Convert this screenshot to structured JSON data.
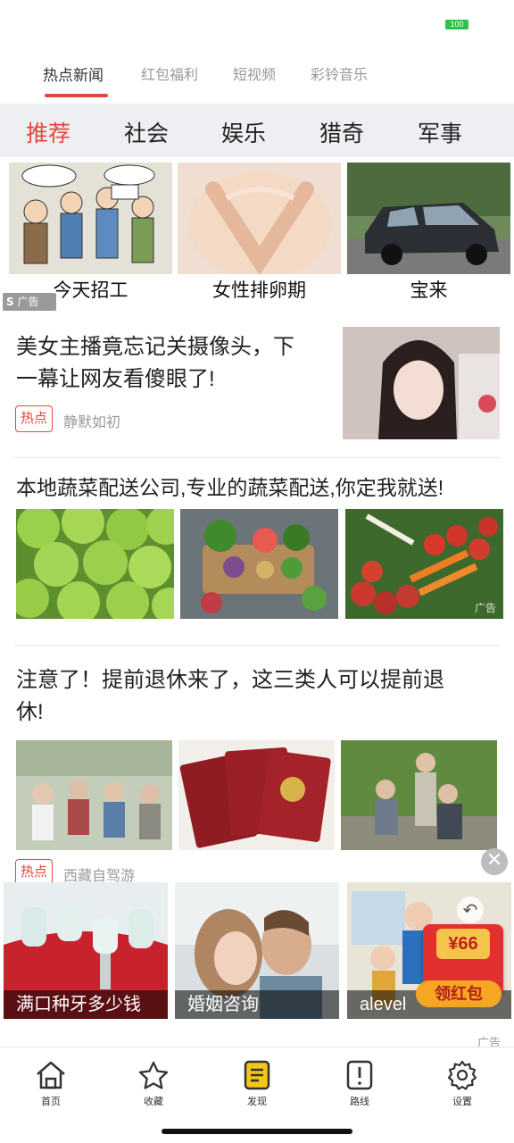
{
  "status": {
    "battery": "100",
    "battery_color": "#2cc24a"
  },
  "top_tabs": [
    {
      "label": "热点新闻"
    },
    {
      "label": "红包福利"
    },
    {
      "label": "短视频"
    },
    {
      "label": "彩铃音乐"
    }
  ],
  "categories": [
    {
      "label": "推荐"
    },
    {
      "label": "社会"
    },
    {
      "label": "娱乐"
    },
    {
      "label": "猎奇"
    },
    {
      "label": "军事"
    }
  ],
  "ad_grid": {
    "items": [
      {
        "caption": "今天招工",
        "image": "recruitment-cartoon-image"
      },
      {
        "caption": "女性排卵期",
        "image": "hands-heart-belly-image"
      },
      {
        "caption": "宝来",
        "image": "black-sedan-car-image"
      }
    ],
    "ad_tag": "广告",
    "ad_tag_icon": "S"
  },
  "articles": [
    {
      "title_line1": "美女主播竟忘记关摄像头，下",
      "title_line2": "一幕让网友看傻眼了!",
      "badge": "热点",
      "source": "静默如初",
      "image": "girl-portrait-image"
    },
    {
      "title": "本地蔬菜配送公司,专业的蔬菜配送,你定我就送!",
      "images": [
        "cabbage-image",
        "vegetables-tray-image",
        "tomatoes-carrots-image"
      ],
      "ad_mark": "广告"
    },
    {
      "title_line1": "注意了！提前退休来了，这三类人可以提前退",
      "title_line2": "休!",
      "images": [
        "elderly-group-image",
        "retirement-certificates-image",
        "elderly-men-park-image"
      ],
      "badge": "热点",
      "source": "西藏自驾游"
    }
  ],
  "bottom_ad": {
    "cards": [
      {
        "label": "满口种牙多少钱",
        "image": "dental-implant-image"
      },
      {
        "label": "婚姻咨询",
        "image": "couple-kissing-image"
      },
      {
        "label": "alevel",
        "image": "teacher-students-image"
      }
    ],
    "red_packet": {
      "amount": "¥66",
      "button": "领红包"
    },
    "ad_mark": "广告"
  },
  "bottom_nav": [
    {
      "label": "首页",
      "icon": "home-icon"
    },
    {
      "label": "收藏",
      "icon": "star-icon"
    },
    {
      "label": "发现",
      "icon": "discover-icon"
    },
    {
      "label": "路线",
      "icon": "route-icon"
    },
    {
      "label": "设置",
      "icon": "settings-icon"
    }
  ],
  "colors": {
    "accent": "#e8453c",
    "category_bg": "#eeeff2",
    "discover_yellow": "#f5c518"
  }
}
